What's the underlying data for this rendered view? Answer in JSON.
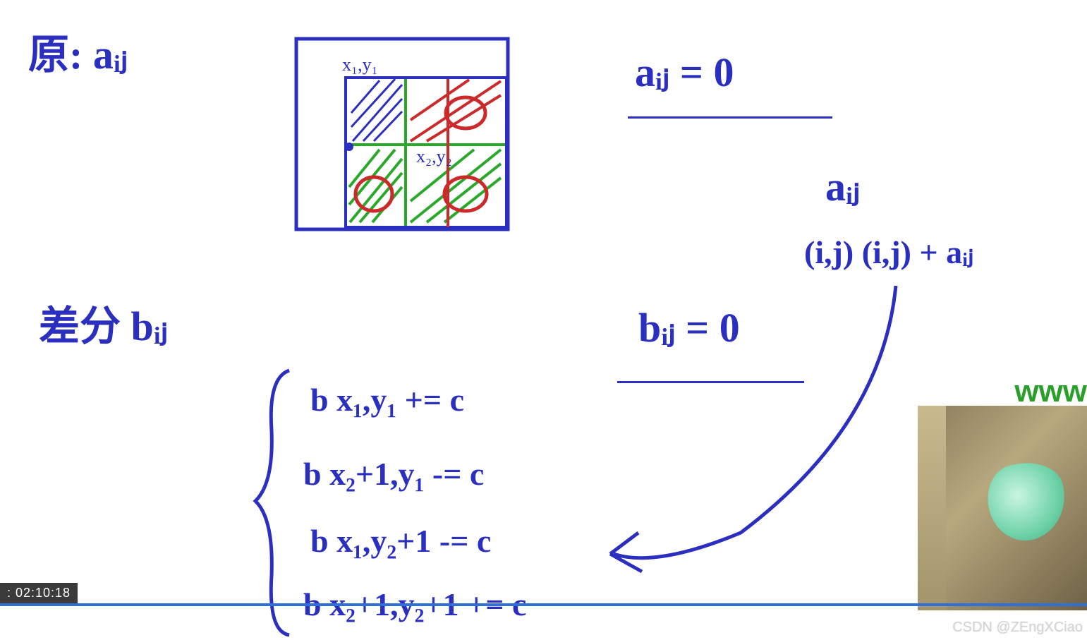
{
  "topLeft": {
    "label": "原:  aᵢⱼ"
  },
  "diagram": {
    "coord1": "x₁,y₁",
    "coord2": "x₂,y₂"
  },
  "topRight": {
    "eq1": "aᵢⱼ = 0",
    "term": "aᵢⱼ",
    "line2": "(i,j)   (i,j)   + aᵢⱼ"
  },
  "midLeft": {
    "label": "差分  bᵢⱼ"
  },
  "midRight": {
    "eq2": "bᵢⱼ = 0"
  },
  "formulas": {
    "f1": "b x₁,y₁  += c",
    "f2": "b x₂+1,y₁  -= c",
    "f3": "b x₁,y₂+1  -= c",
    "f4": "b x₂+1,y₂+1  += c"
  },
  "overlay": {
    "timestamp": ": 02:10:18",
    "www": "www",
    "watermark": "CSDN @ZEngXCiao"
  }
}
